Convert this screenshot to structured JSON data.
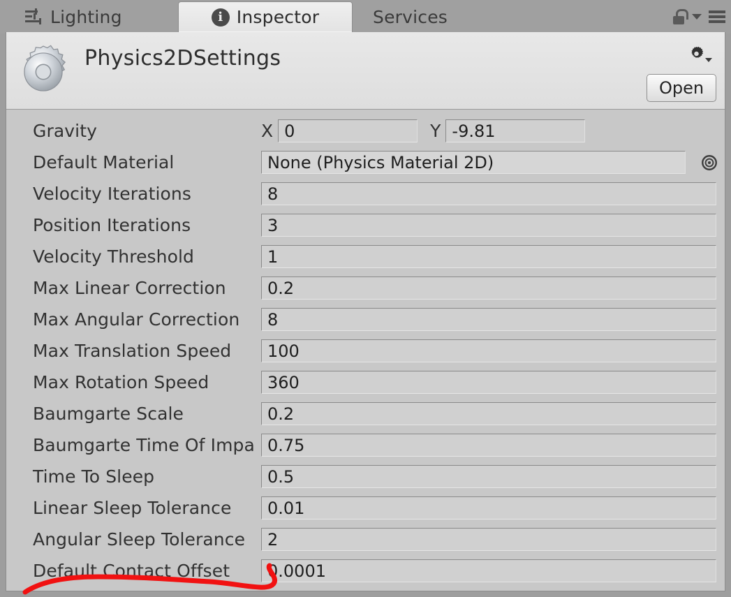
{
  "tabs": [
    {
      "label": "Lighting",
      "icon": "sliders-icon",
      "active": false
    },
    {
      "label": "Inspector",
      "icon": "info-icon",
      "active": true
    },
    {
      "label": "Services",
      "icon": "",
      "active": false
    }
  ],
  "tabbar_controls": {
    "lock": "lock-icon",
    "menu_caret": "caret-down-icon",
    "menu": "hamburger-icon"
  },
  "header": {
    "icon": "gear-icon",
    "title": "Physics2DSettings",
    "settings_icon": "gear-small-icon",
    "open_label": "Open"
  },
  "properties": {
    "gravity": {
      "label": "Gravity",
      "x_axis_label": "X",
      "x_value": "0",
      "y_axis_label": "Y",
      "y_value": "-9.81"
    },
    "default_material": {
      "label": "Default Material",
      "value": "None (Physics Material 2D)",
      "picker_icon": "object-picker-icon"
    },
    "rows": [
      {
        "label": "Velocity Iterations",
        "value": "8"
      },
      {
        "label": "Position Iterations",
        "value": "3"
      },
      {
        "label": "Velocity Threshold",
        "value": "1"
      },
      {
        "label": "Max Linear Correction",
        "value": "0.2"
      },
      {
        "label": "Max Angular Correction",
        "value": "8"
      },
      {
        "label": "Max Translation Speed",
        "value": "100"
      },
      {
        "label": "Max Rotation Speed",
        "value": "360"
      },
      {
        "label": "Baumgarte Scale",
        "value": "0.2"
      },
      {
        "label": "Baumgarte Time Of Impa",
        "value": "0.75"
      },
      {
        "label": "Time To Sleep",
        "value": "0.5"
      },
      {
        "label": "Linear Sleep Tolerance",
        "value": "0.01"
      },
      {
        "label": "Angular Sleep Tolerance",
        "value": "2"
      },
      {
        "label": "Default Contact Offset",
        "value": "0.0001"
      }
    ]
  },
  "annotation": {
    "type": "freehand-underline",
    "color": "#f11111",
    "target_label": "Default Contact Offset"
  },
  "colors": {
    "tabbar_bg": "#a0a0a0",
    "panel_bg": "#c8c8c8",
    "header_bg": "#e4e4e4",
    "field_bg": "#d0d0d0",
    "text": "#313131",
    "annotation_red": "#f11111"
  }
}
